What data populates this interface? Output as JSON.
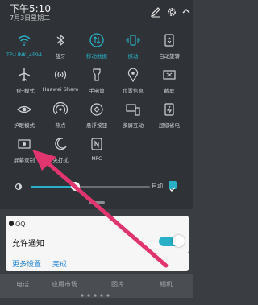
{
  "status": {
    "time": "下午5:10",
    "date": "7月3日星期二"
  },
  "tiles": [
    {
      "label": "TP-LINK_4F94",
      "icon": "wifi-icon",
      "active": true
    },
    {
      "label": "蓝牙",
      "icon": "bluetooth-icon",
      "active": false
    },
    {
      "label": "移动数据",
      "icon": "mobile-data-icon",
      "active": true
    },
    {
      "label": "振动",
      "icon": "vibrate-icon",
      "active": true
    },
    {
      "label": "自动旋转",
      "icon": "auto-rotate-icon",
      "active": false
    },
    {
      "label": "飞行模式",
      "icon": "airplane-icon",
      "active": false
    },
    {
      "label": "Huawei Share",
      "icon": "huawei-share-icon",
      "active": false
    },
    {
      "label": "手电筒",
      "icon": "flashlight-icon",
      "active": false
    },
    {
      "label": "位置信息",
      "icon": "location-icon",
      "active": false
    },
    {
      "label": "截屏",
      "icon": "screenshot-icon",
      "active": false
    },
    {
      "label": "护眼模式",
      "icon": "eye-comfort-icon",
      "active": false
    },
    {
      "label": "热点",
      "icon": "hotspot-icon",
      "active": false
    },
    {
      "label": "悬浮按钮",
      "icon": "floating-button-icon",
      "active": false
    },
    {
      "label": "多屏互动",
      "icon": "multi-screen-icon",
      "active": false
    },
    {
      "label": "超级省电",
      "icon": "power-saving-icon",
      "active": false
    },
    {
      "label": "屏幕录制",
      "icon": "screen-record-icon",
      "active": false
    },
    {
      "label": "免打扰",
      "icon": "do-not-disturb-icon",
      "active": false
    },
    {
      "label": "NFC",
      "icon": "nfc-icon",
      "active": false
    }
  ],
  "brightness": {
    "auto_label": "自动",
    "auto_checked": true
  },
  "notification": {
    "app": "QQ",
    "title": "允许通知",
    "toggle_on": true,
    "more_settings": "更多设置",
    "done": "完成"
  },
  "dock": {
    "items": [
      "电话",
      "应用市场",
      "图库",
      "相机"
    ]
  },
  "colors": {
    "accent": "#2ab0c6",
    "arrow": "#e0356e"
  }
}
